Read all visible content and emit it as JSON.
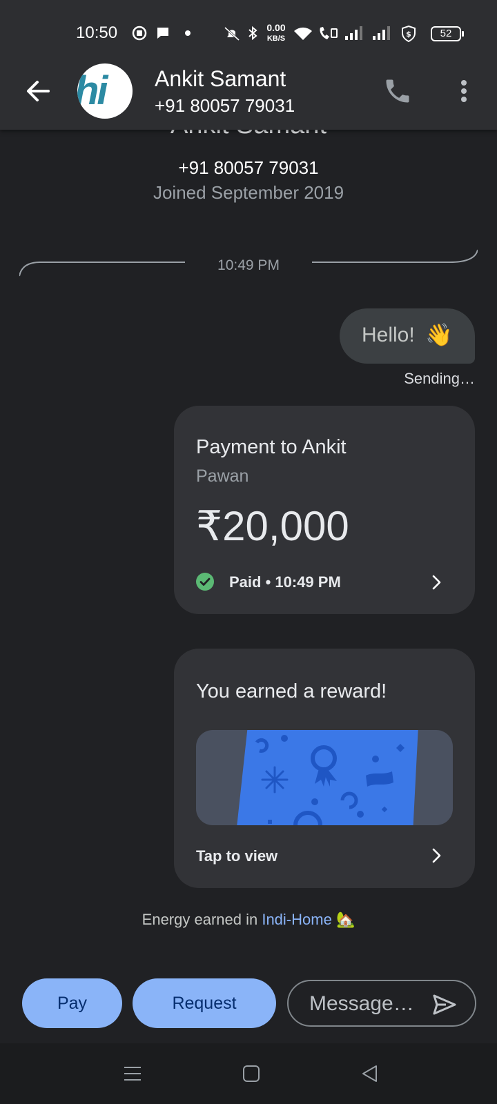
{
  "status_bar": {
    "time": "10:50",
    "net_speed_value": "0.00",
    "net_speed_unit": "KB/S",
    "battery": "52"
  },
  "header": {
    "name": "Ankit Samant",
    "phone": "+91 80057 79031",
    "avatar_text": "hi"
  },
  "contact": {
    "name": "Ankit Samant",
    "phone": "+91 80057 79031",
    "joined": "Joined September 2019"
  },
  "thread": {
    "divider_time": "10:49 PM",
    "hello_message": "Hello!",
    "hello_emoji": "👋",
    "hello_status": "Sending…"
  },
  "payment": {
    "title": "Payment to Ankit",
    "subtitle": "Pawan",
    "amount": "₹20,000",
    "status": "Paid • 10:49 PM"
  },
  "reward": {
    "title": "You earned a reward!",
    "action": "Tap to view"
  },
  "energy": {
    "prefix": "Energy earned in ",
    "link": "Indi-Home",
    "emoji": "🏡"
  },
  "composer": {
    "pay_label": "Pay",
    "request_label": "Request",
    "message_placeholder": "Message…"
  },
  "colors": {
    "background": "#202124",
    "accent": "#8ab4f8",
    "success": "#5bb974",
    "reward_card": "#3b78e7"
  }
}
